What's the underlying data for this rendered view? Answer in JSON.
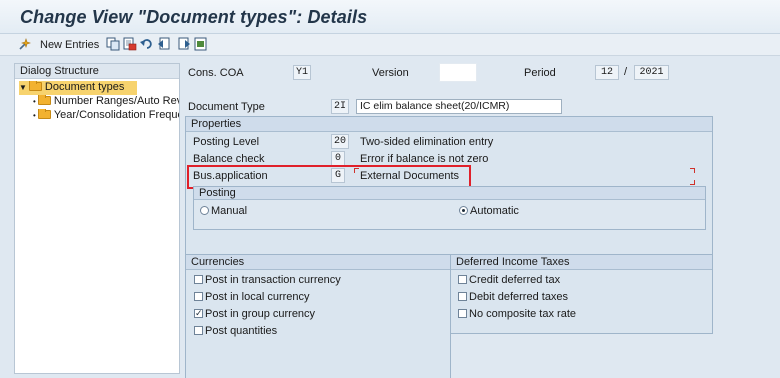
{
  "window": {
    "title": "Change View \"Document types\": Details"
  },
  "toolbar": {
    "new_entries_label": "New Entries",
    "icons": [
      "new-entries-icon",
      "copy-icon",
      "delete-icon",
      "undo-icon",
      "previous-entry-icon",
      "next-entry-icon",
      "select-all-icon"
    ]
  },
  "sidebar": {
    "header": "Dialog Structure",
    "items": [
      {
        "label": "Document types",
        "level": 0,
        "selected": true
      },
      {
        "label": "Number Ranges/Auto Reve",
        "level": 1,
        "selected": false
      },
      {
        "label": "Year/Consolidation Freque",
        "level": 1,
        "selected": false
      }
    ]
  },
  "header_fields": {
    "cons_coa_label": "Cons. COA",
    "cons_coa_value": "Y1",
    "version_label": "Version",
    "version_value": "",
    "period_label": "Period",
    "period_value": "12",
    "period_sep": "/",
    "year_value": "2021"
  },
  "document_type": {
    "label": "Document Type",
    "code": "2I",
    "description": "IC elim balance sheet(20/ICMR)"
  },
  "properties": {
    "title": "Properties",
    "rows": [
      {
        "label": "Posting Level",
        "value": "20",
        "text": "Two-sided elimination entry"
      },
      {
        "label": "Balance check",
        "value": "0",
        "text": "Error if balance is not zero"
      },
      {
        "label": "Bus.application",
        "value": "G",
        "text": "External Documents"
      }
    ],
    "posting": {
      "title": "Posting",
      "manual_label": "Manual",
      "automatic_label": "Automatic",
      "selected": "Automatic"
    }
  },
  "currencies": {
    "title": "Currencies",
    "options": [
      {
        "label": "Post in transaction currency",
        "checked": false
      },
      {
        "label": "Post in local currency",
        "checked": false
      },
      {
        "label": "Post in group currency",
        "checked": true
      },
      {
        "label": "Post quantities",
        "checked": false
      }
    ]
  },
  "deferred_taxes": {
    "title": "Deferred Income Taxes",
    "options": [
      {
        "label": "Credit deferred tax",
        "checked": false
      },
      {
        "label": "Debit deferred taxes",
        "checked": false
      },
      {
        "label": "No composite tax rate",
        "checked": false
      }
    ]
  },
  "colors": {
    "highlight": "#e0202a",
    "selection": "#f7d36e"
  }
}
